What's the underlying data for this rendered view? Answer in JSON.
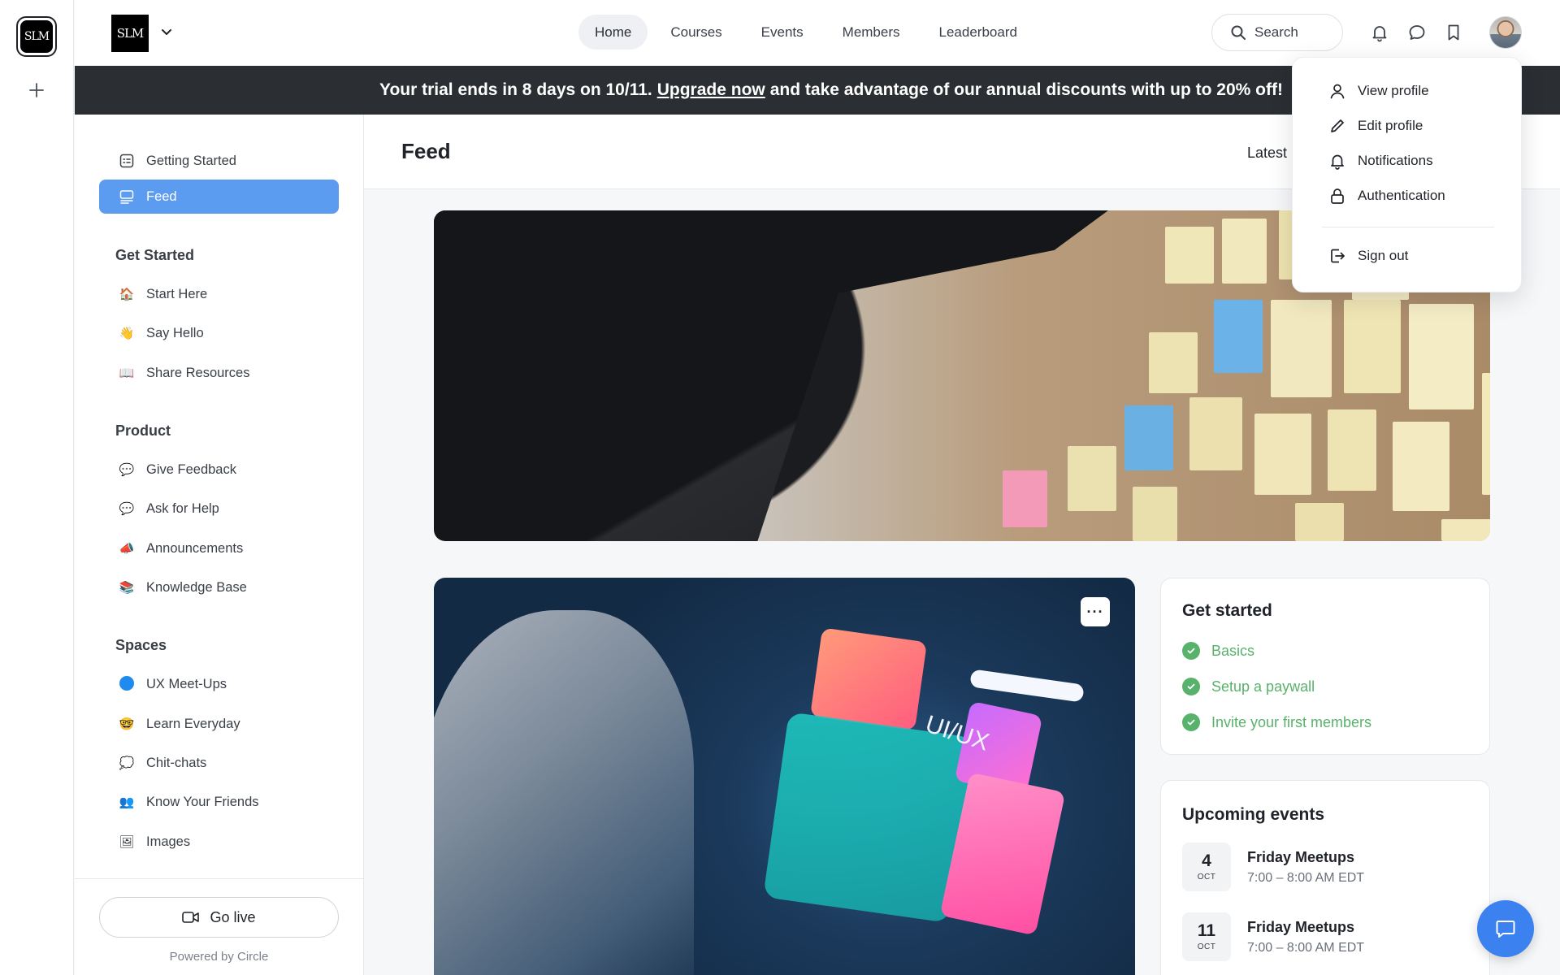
{
  "rail": {
    "logo_text": "SLM",
    "add_icon": "plus-icon"
  },
  "header": {
    "brand_text": "SLM",
    "nav": [
      {
        "label": "Home",
        "active": true
      },
      {
        "label": "Courses",
        "active": false
      },
      {
        "label": "Events",
        "active": false
      },
      {
        "label": "Members",
        "active": false
      },
      {
        "label": "Leaderboard",
        "active": false
      }
    ],
    "search_label": "Search"
  },
  "banner": {
    "text_before": "Your trial ends in 8 days on 10/11.",
    "link": "Upgrade now",
    "text_after": "and take advantage of our annual discounts with up to 20% off!"
  },
  "sidebar": {
    "top_items": [
      {
        "label": "Getting Started",
        "icon": "checklist-icon"
      },
      {
        "label": "Feed",
        "icon": "feed-icon",
        "active": true
      }
    ],
    "sections": [
      {
        "heading": "Get Started",
        "items": [
          {
            "label": "Start Here",
            "emoji": "🏠"
          },
          {
            "label": "Say Hello",
            "emoji": "👋"
          },
          {
            "label": "Share Resources",
            "emoji": "📖"
          }
        ]
      },
      {
        "heading": "Product",
        "items": [
          {
            "label": "Give Feedback",
            "emoji": "💬"
          },
          {
            "label": "Ask for Help",
            "emoji": "💬"
          },
          {
            "label": "Announcements",
            "emoji": "📣"
          },
          {
            "label": "Knowledge Base",
            "emoji": "📚"
          }
        ]
      },
      {
        "heading": "Spaces",
        "items": [
          {
            "label": "UX Meet-Ups",
            "emoji": "dot"
          },
          {
            "label": "Learn Everyday",
            "emoji": "🤓"
          },
          {
            "label": "Chit-chats",
            "emoji": "💭"
          },
          {
            "label": "Know Your Friends",
            "emoji": "👥"
          },
          {
            "label": "Images",
            "emoji": "🖼"
          }
        ]
      }
    ],
    "go_live": "Go live",
    "powered_by": "Powered by Circle"
  },
  "feed": {
    "title": "Feed",
    "sort_label": "Latest"
  },
  "get_started": {
    "title": "Get started",
    "items": [
      "Basics",
      "Setup a paywall",
      "Invite your first members"
    ]
  },
  "upcoming_events": {
    "title": "Upcoming events",
    "events": [
      {
        "day": "4",
        "month": "OCT",
        "name": "Friday Meetups",
        "time": "7:00 – 8:00 AM EDT"
      },
      {
        "day": "11",
        "month": "OCT",
        "name": "Friday Meetups",
        "time": "7:00 – 8:00 AM EDT"
      }
    ]
  },
  "post": {
    "graphic_text": "UI/UX",
    "menu_label": "···"
  },
  "profile_menu": {
    "items": [
      {
        "label": "View profile",
        "icon": "user-icon"
      },
      {
        "label": "Edit profile",
        "icon": "pencil-icon"
      },
      {
        "label": "Notifications",
        "icon": "bell-icon"
      },
      {
        "label": "Authentication",
        "icon": "lock-icon"
      }
    ],
    "sign_out": "Sign out"
  },
  "colors": {
    "accent": "#5c9cf0",
    "banner_bg": "#2b2e33",
    "success": "#58b26b",
    "chat_fab": "#3b82f0"
  }
}
